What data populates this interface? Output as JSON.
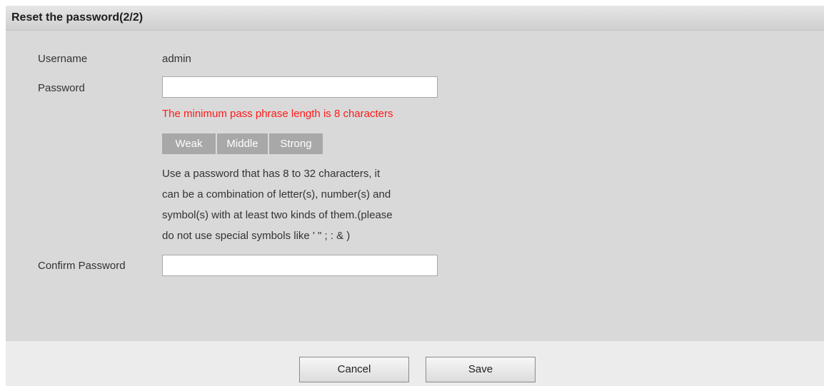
{
  "dialog": {
    "title": "Reset the password(2/2)"
  },
  "form": {
    "username_label": "Username",
    "username_value": "admin",
    "password_label": "Password",
    "password_value": "",
    "password_error": "The minimum pass phrase length is 8 characters",
    "strength": {
      "weak": "Weak",
      "middle": "Middle",
      "strong": "Strong"
    },
    "hint_lines": [
      "Use a password that has 8 to 32 characters, it",
      "can be a combination of letter(s), number(s) and",
      "symbol(s) with at least two kinds of them.(please",
      "do not use special symbols like ' \" ; : & )"
    ],
    "confirm_label": "Confirm Password",
    "confirm_value": ""
  },
  "footer": {
    "cancel_label": "Cancel",
    "save_label": "Save"
  }
}
